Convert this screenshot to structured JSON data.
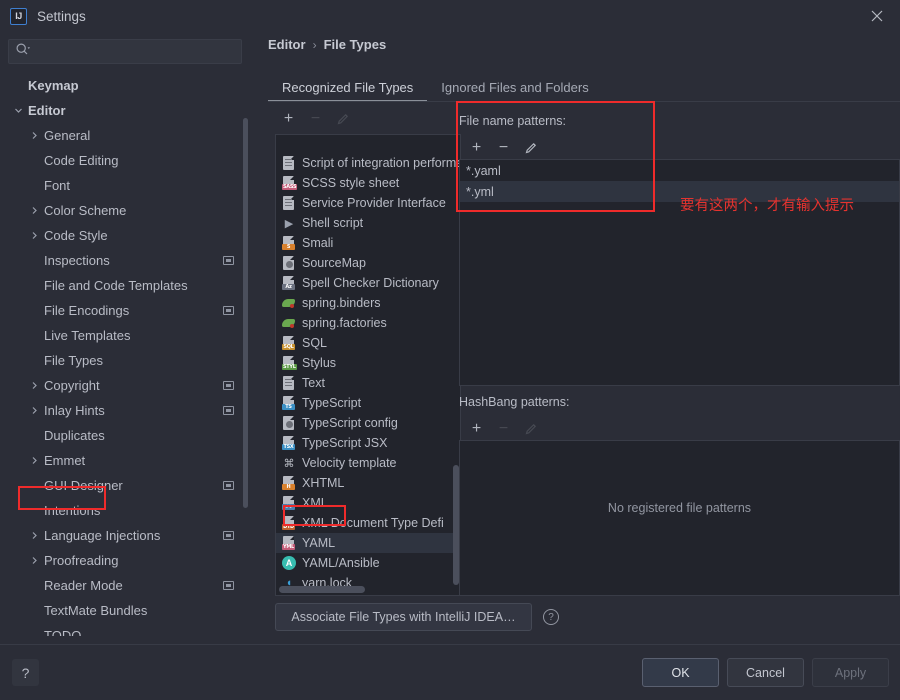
{
  "window": {
    "title": "Settings",
    "logo_text": "IJ",
    "close_icon": "close-icon"
  },
  "sidebar": {
    "search": {
      "value": "",
      "placeholder": ""
    },
    "items": [
      {
        "label": "Keymap",
        "level": 0,
        "arrow": "",
        "badge": false,
        "selected": false,
        "bold": true
      },
      {
        "label": "Editor",
        "level": 0,
        "arrow": "v",
        "badge": false,
        "selected": false,
        "bold": true
      },
      {
        "label": "General",
        "level": 1,
        "arrow": ">",
        "badge": false,
        "selected": false
      },
      {
        "label": "Code Editing",
        "level": 1,
        "arrow": "",
        "badge": false,
        "selected": false
      },
      {
        "label": "Font",
        "level": 1,
        "arrow": "",
        "badge": false,
        "selected": false
      },
      {
        "label": "Color Scheme",
        "level": 1,
        "arrow": ">",
        "badge": false,
        "selected": false
      },
      {
        "label": "Code Style",
        "level": 1,
        "arrow": ">",
        "badge": false,
        "selected": false
      },
      {
        "label": "Inspections",
        "level": 1,
        "arrow": "",
        "badge": true,
        "selected": false
      },
      {
        "label": "File and Code Templates",
        "level": 1,
        "arrow": "",
        "badge": false,
        "selected": false
      },
      {
        "label": "File Encodings",
        "level": 1,
        "arrow": "",
        "badge": true,
        "selected": false
      },
      {
        "label": "Live Templates",
        "level": 1,
        "arrow": "",
        "badge": false,
        "selected": false
      },
      {
        "label": "File Types",
        "level": 1,
        "arrow": "",
        "badge": false,
        "selected": true
      },
      {
        "label": "Copyright",
        "level": 1,
        "arrow": ">",
        "badge": true,
        "selected": false
      },
      {
        "label": "Inlay Hints",
        "level": 1,
        "arrow": ">",
        "badge": true,
        "selected": false
      },
      {
        "label": "Duplicates",
        "level": 1,
        "arrow": "",
        "badge": false,
        "selected": false
      },
      {
        "label": "Emmet",
        "level": 1,
        "arrow": ">",
        "badge": false,
        "selected": false
      },
      {
        "label": "GUI Designer",
        "level": 1,
        "arrow": "",
        "badge": true,
        "selected": false
      },
      {
        "label": "Intentions",
        "level": 1,
        "arrow": "",
        "badge": false,
        "selected": false
      },
      {
        "label": "Language Injections",
        "level": 1,
        "arrow": ">",
        "badge": true,
        "selected": false
      },
      {
        "label": "Proofreading",
        "level": 1,
        "arrow": ">",
        "badge": false,
        "selected": false
      },
      {
        "label": "Reader Mode",
        "level": 1,
        "arrow": "",
        "badge": true,
        "selected": false
      },
      {
        "label": "TextMate Bundles",
        "level": 1,
        "arrow": "",
        "badge": false,
        "selected": false
      },
      {
        "label": "TODO",
        "level": 1,
        "arrow": "",
        "badge": false,
        "selected": false
      }
    ]
  },
  "breadcrumb": {
    "parent": "Editor",
    "separator": "›",
    "current": "File Types"
  },
  "tabs": [
    {
      "label": "Recognized File Types",
      "active": true
    },
    {
      "label": "Ignored Files and Folders",
      "active": false
    }
  ],
  "file_types": {
    "toolbar": [
      {
        "icon": "add-icon",
        "glyph": "+",
        "disabled": false
      },
      {
        "icon": "remove-icon",
        "glyph": "−",
        "disabled": true
      },
      {
        "icon": "edit-icon",
        "glyph": "pencil",
        "disabled": true
      }
    ],
    "items": [
      {
        "label": "Script of integration performa",
        "icon": "script-file-icon",
        "kind": "doc",
        "tag": "",
        "tagcolor": "",
        "selected": false,
        "clipped": true
      },
      {
        "label": "SCSS style sheet",
        "icon": "scss-file-icon",
        "kind": "tag",
        "tag": "SASS",
        "tagcolor": "#c45d7a",
        "selected": false
      },
      {
        "label": "Service Provider Interface",
        "icon": "spi-file-icon",
        "kind": "doc",
        "tag": "",
        "tagcolor": "",
        "selected": false,
        "clipped": true
      },
      {
        "label": "Shell script",
        "icon": "shell-file-icon",
        "kind": "glyph",
        "glyph": "▶",
        "tagcolor": "#9aa0ad",
        "selected": false
      },
      {
        "label": "Smali",
        "icon": "smali-file-icon",
        "kind": "tag",
        "tag": "S",
        "tagcolor": "#d8802c",
        "selected": false
      },
      {
        "label": "SourceMap",
        "icon": "sourcemap-file-icon",
        "kind": "gear",
        "tag": "",
        "tagcolor": "",
        "selected": false
      },
      {
        "label": "Spell Checker Dictionary",
        "icon": "dictionary-file-icon",
        "kind": "tag",
        "tag": "Az",
        "tagcolor": "#6b7180",
        "selected": false
      },
      {
        "label": "spring.binders",
        "icon": "spring-file-icon",
        "kind": "leaf",
        "tag": "",
        "tagcolor": "#6aa84f",
        "selected": false
      },
      {
        "label": "spring.factories",
        "icon": "spring-file-icon",
        "kind": "leaf",
        "tag": "",
        "tagcolor": "#6aa84f",
        "selected": false
      },
      {
        "label": "SQL",
        "icon": "sql-file-icon",
        "kind": "tag",
        "tag": "SQL",
        "tagcolor": "#c8912e",
        "selected": false
      },
      {
        "label": "Stylus",
        "icon": "stylus-file-icon",
        "kind": "tag",
        "tag": "STYL",
        "tagcolor": "#5b9a46",
        "selected": false
      },
      {
        "label": "Text",
        "icon": "text-file-icon",
        "kind": "doc",
        "tag": "",
        "tagcolor": "",
        "selected": false
      },
      {
        "label": "TypeScript",
        "icon": "typescript-file-icon",
        "kind": "tag",
        "tag": "TS",
        "tagcolor": "#3a8fc4",
        "selected": false
      },
      {
        "label": "TypeScript config",
        "icon": "tsconfig-file-icon",
        "kind": "gear",
        "tag": "",
        "tagcolor": "",
        "selected": false
      },
      {
        "label": "TypeScript JSX",
        "icon": "tsx-file-icon",
        "kind": "tag",
        "tag": "TSX",
        "tagcolor": "#3a8fc4",
        "selected": false
      },
      {
        "label": "Velocity template",
        "icon": "velocity-file-icon",
        "kind": "glyph",
        "glyph": "⌘",
        "tagcolor": "#b7bac2",
        "selected": false
      },
      {
        "label": "XHTML",
        "icon": "xhtml-file-icon",
        "kind": "tag",
        "tag": "H",
        "tagcolor": "#d8802c",
        "selected": false
      },
      {
        "label": "XML",
        "icon": "xml-file-icon",
        "kind": "tag",
        "tag": "< >",
        "tagcolor": "#4a7fae",
        "selected": false
      },
      {
        "label": "XML Document Type Defi",
        "icon": "dtd-file-icon",
        "kind": "tag",
        "tag": "DTD",
        "tagcolor": "#c0622f",
        "selected": false,
        "clipped": true
      },
      {
        "label": "YAML",
        "icon": "yaml-file-icon",
        "kind": "tag",
        "tag": "YML",
        "tagcolor": "#c45d7a",
        "selected": true
      },
      {
        "label": "YAML/Ansible",
        "icon": "ansible-file-icon",
        "kind": "circle",
        "tag": "A",
        "tagcolor": "#37bdb0",
        "selected": false
      },
      {
        "label": "yarn.lock",
        "icon": "yarn-file-icon",
        "kind": "glyph",
        "glyph": "◖",
        "tagcolor": "#3a9fd8",
        "selected": false
      }
    ]
  },
  "patterns": {
    "label": "File name patterns:",
    "toolbar": [
      {
        "icon": "add-icon",
        "glyph": "+",
        "disabled": false
      },
      {
        "icon": "remove-icon",
        "glyph": "−",
        "disabled": false
      },
      {
        "icon": "edit-icon",
        "glyph": "pencil",
        "disabled": false
      }
    ],
    "items": [
      {
        "label": "*.yaml",
        "selected": false
      },
      {
        "label": "*.yml",
        "selected": true
      }
    ]
  },
  "hashbang": {
    "label": "HashBang patterns:",
    "toolbar": [
      {
        "icon": "add-icon",
        "glyph": "+",
        "disabled": false
      },
      {
        "icon": "remove-icon",
        "glyph": "−",
        "disabled": true
      },
      {
        "icon": "edit-icon",
        "glyph": "pencil",
        "disabled": true
      }
    ],
    "empty_message": "No registered file patterns"
  },
  "annotation": {
    "text": "要有这两个，才有输入提示",
    "color": "#e5332f"
  },
  "footer": {
    "associate_button": "Associate File Types with IntelliJ IDEA…",
    "help_icon": "question-mark-icon"
  },
  "dialog_buttons": {
    "help": "?",
    "ok": "OK",
    "cancel": "Cancel",
    "apply": "Apply",
    "apply_disabled": true
  },
  "colors": {
    "background": "#2b2d37",
    "list_background": "#22242c",
    "selection": "#2f3440",
    "accent_red": "#ef2b2b",
    "text": "#b9bcc6"
  }
}
